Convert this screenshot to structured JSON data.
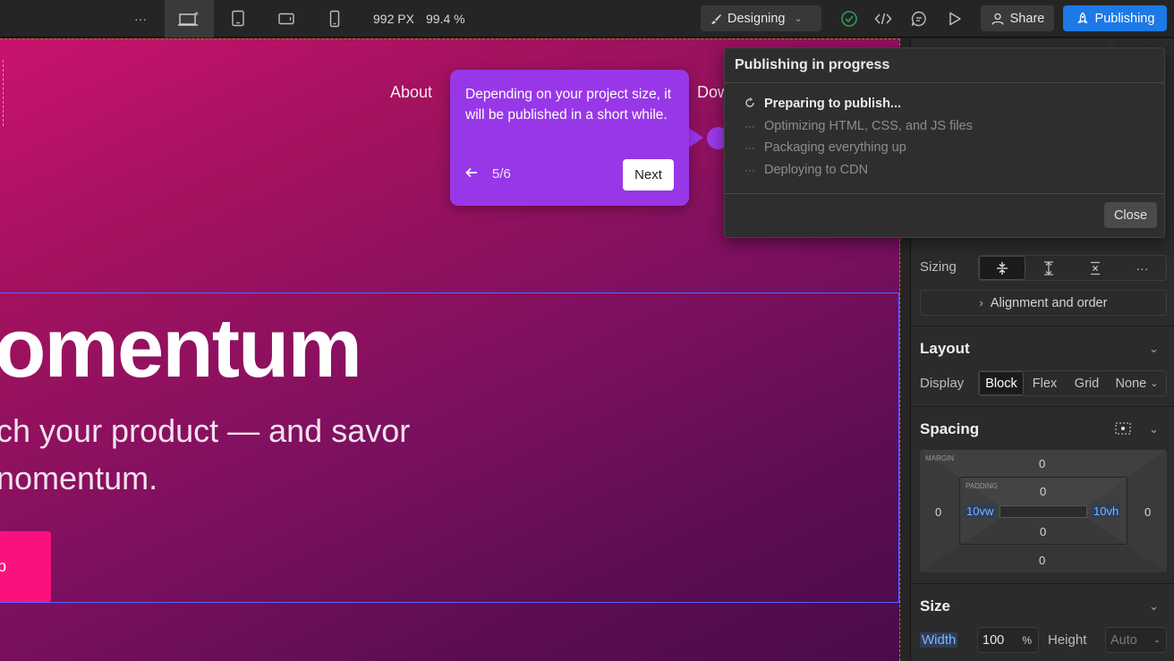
{
  "toolbar": {
    "more_label": "···",
    "canvas_width": "992 PX",
    "zoom": "99.4 %",
    "mode_label": "Designing",
    "share_label": "Share",
    "publish_label": "Publishing"
  },
  "canvas": {
    "nav": [
      "About",
      "Dow"
    ],
    "hero_title": "omentum",
    "hero_sub_line1": "ch your product — and savor",
    "hero_sub_line2": "nomentum.",
    "cta_label": "p"
  },
  "tour": {
    "text": "Depending on your project size, it will be published in a short while.",
    "step": "5/6",
    "next_label": "Next",
    "back_icon": "arrow-left"
  },
  "publishing": {
    "title": "Publishing in progress",
    "steps": [
      {
        "label": "Preparing to publish...",
        "state": "active"
      },
      {
        "label": "Optimizing HTML, CSS, and JS files",
        "state": "pending"
      },
      {
        "label": "Packaging everything up",
        "state": "pending"
      },
      {
        "label": "Deploying to CDN",
        "state": "pending"
      }
    ],
    "close_label": "Close"
  },
  "panel": {
    "sizing_label": "Sizing",
    "sizing_more": "···",
    "alignment_label": "Alignment and order",
    "layout": {
      "title": "Layout",
      "display_label": "Display",
      "options": [
        "Block",
        "Flex",
        "Grid",
        "None"
      ],
      "selected": "Block"
    },
    "spacing": {
      "title": "Spacing",
      "margin_tag": "MARGIN",
      "padding_tag": "PADDING",
      "margin": {
        "top": "0",
        "right": "0",
        "bottom": "0",
        "left": "0"
      },
      "padding": {
        "top": "0",
        "right": "10vh",
        "bottom": "0",
        "left": "10vw"
      }
    },
    "size": {
      "title": "Size",
      "width_label": "Width",
      "width_value": "100",
      "width_unit": "%",
      "height_label": "Height",
      "height_value": "Auto",
      "height_unit": "-"
    }
  },
  "colors": {
    "accent": "#1c79e6",
    "tour": "#9837e8",
    "cta": "#fb117d",
    "published_ok": "#2e9d5a"
  }
}
